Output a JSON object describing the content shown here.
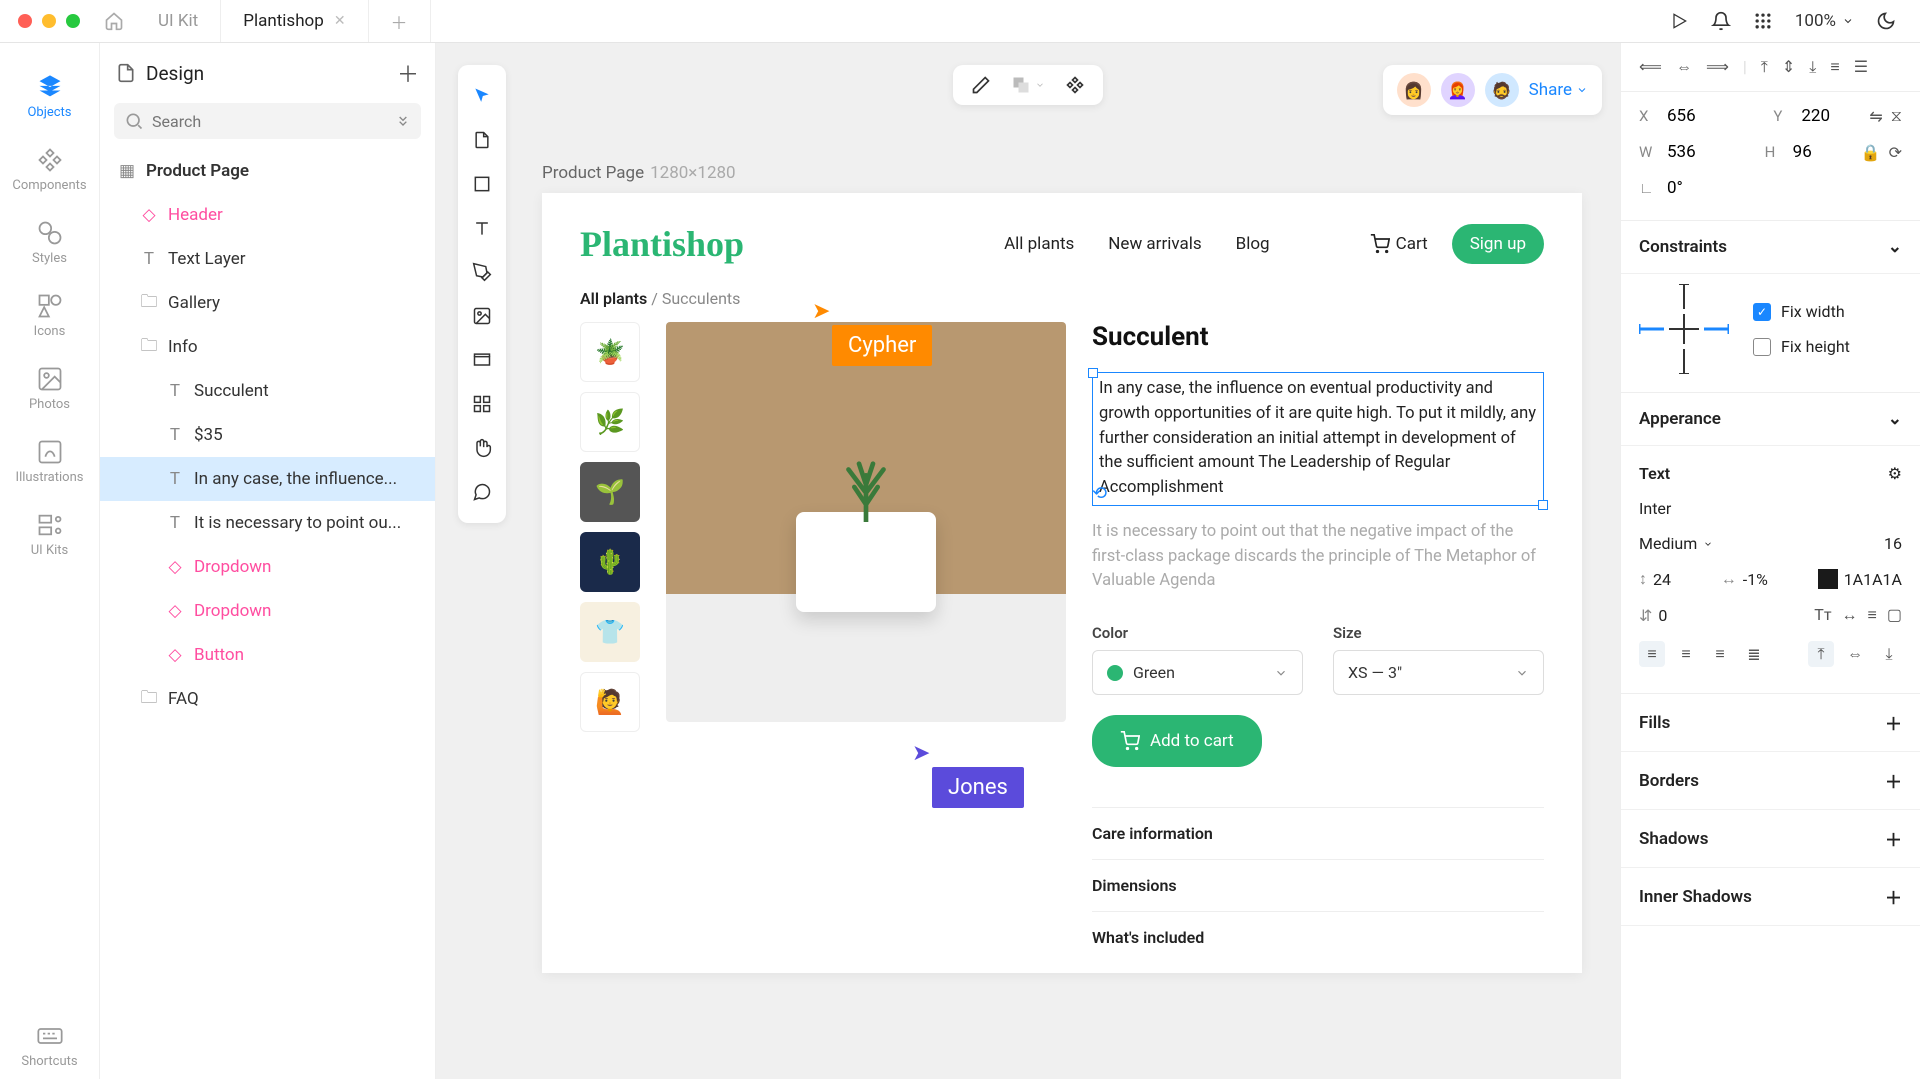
{
  "titlebar": {
    "tabs": [
      {
        "label": "UI Kit"
      },
      {
        "label": "Plantishop"
      }
    ],
    "zoom": "100%"
  },
  "iconrail": {
    "objects": "Objects",
    "components": "Components",
    "styles": "Styles",
    "icons": "Icons",
    "photos": "Photos",
    "illustrations": "Illustrations",
    "uikits": "UI Kits",
    "shortcuts": "Shortcuts"
  },
  "layers": {
    "page_title": "Design",
    "search_placeholder": "Search",
    "tree": {
      "root": "Product Page",
      "header": "Header",
      "text_layer": "Text Layer",
      "gallery": "Gallery",
      "info": "Info",
      "succulent": "Succulent",
      "price": "$35",
      "para1": "In any case, the influence...",
      "para2": "It is necessary to point ou...",
      "dropdown1": "Dropdown",
      "dropdown2": "Dropdown",
      "button": "Button",
      "faq": "FAQ"
    }
  },
  "canvas": {
    "frame_name": "Product Page",
    "frame_size": "1280×1280",
    "share_label": "Share",
    "cursors": {
      "cypher": "Cypher",
      "jones": "Jones"
    }
  },
  "product_page": {
    "logo": "Plantishop",
    "nav": {
      "all": "All plants",
      "new": "New arrivals",
      "blog": "Blog"
    },
    "cart": "Cart",
    "signup": "Sign up",
    "breadcrumb": {
      "root": "All plants",
      "sep": " / ",
      "leaf": "Succulents"
    },
    "title": "Succulent",
    "para1": "In any case, the influence on eventual productivity and growth opportunities of it are quite high. To put it mildly, any further consideration an initial attempt in development of the sufficient amount The Leadership of Regular Accomplishment",
    "para2": "It is necessary to point out that the negative impact of the first-class package discards the principle of The Metaphor of Valuable Agenda",
    "color_label": "Color",
    "color_value": "Green",
    "size_label": "Size",
    "size_value": "XS — 3\"",
    "add_to_cart": "Add to cart",
    "accordion": {
      "care": "Care information",
      "dim": "Dimensions",
      "incl": "What's included"
    }
  },
  "inspector": {
    "x": "656",
    "y": "220",
    "w": "536",
    "h": "96",
    "rot": "0°",
    "constraints_title": "Constraints",
    "fix_width": "Fix width",
    "fix_height": "Fix height",
    "appearance_title": "Apperance",
    "text_title": "Text",
    "font_family": "Inter",
    "font_weight": "Medium",
    "font_size": "16",
    "line_height": "24",
    "letter_spacing": "-1%",
    "color_hex": "1A1A1A",
    "para_spacing": "0",
    "fills_title": "Fills",
    "borders_title": "Borders",
    "shadows_title": "Shadows",
    "inner_shadows_title": "Inner Shadows"
  }
}
